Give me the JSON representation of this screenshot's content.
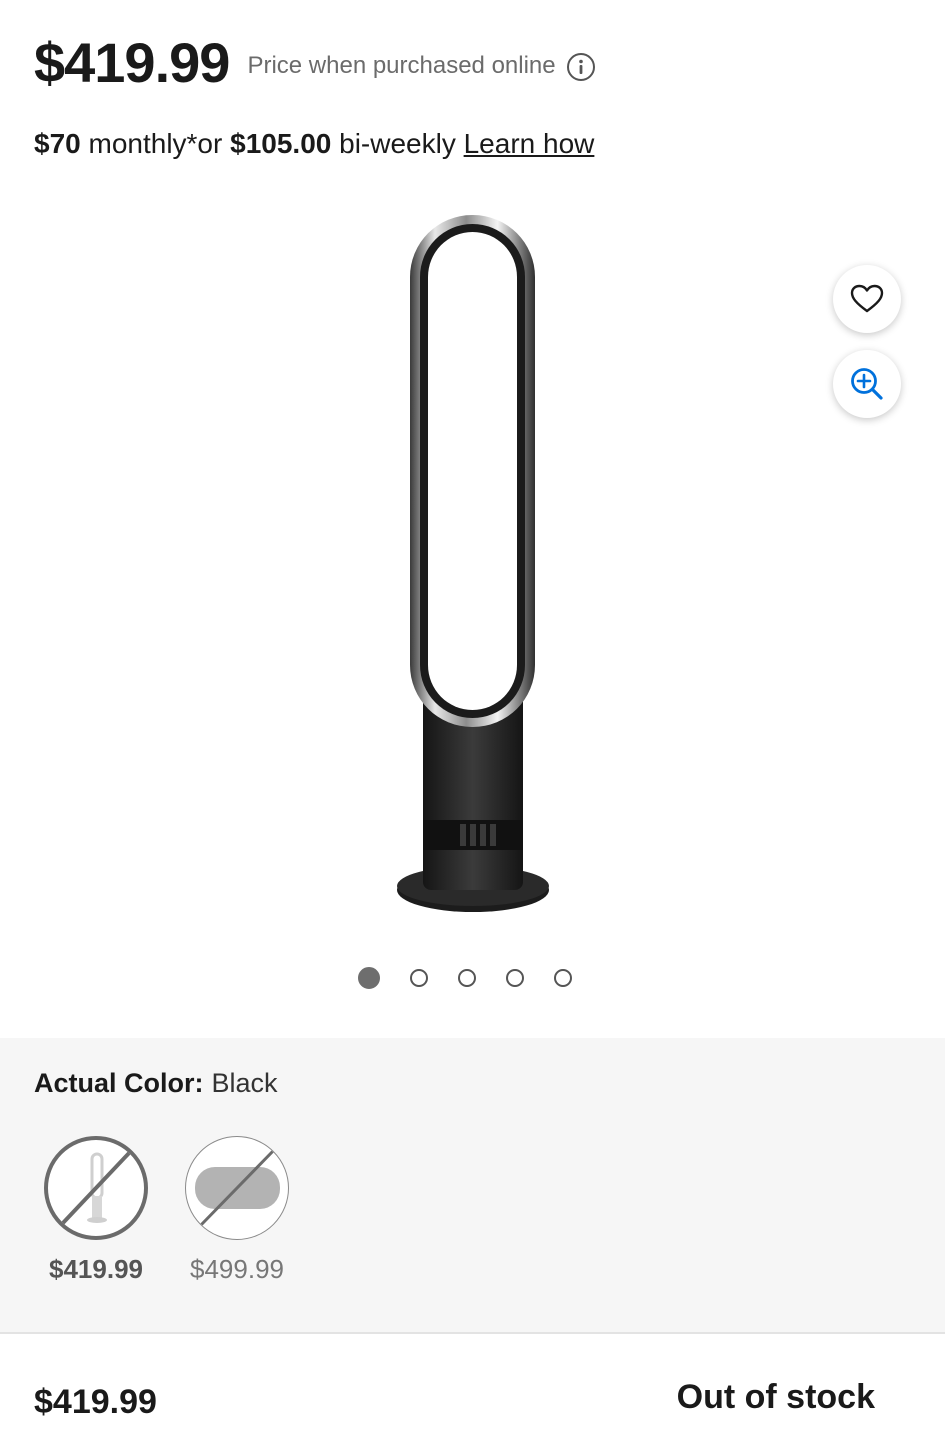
{
  "header": {
    "price": "$419.99",
    "price_note": "Price when purchased online"
  },
  "financing": {
    "monthly_amount": "$70",
    "monthly_text": " monthly*or ",
    "biweekly_amount": "$105.00",
    "biweekly_text": " bi-weekly ",
    "link": "Learn how"
  },
  "gallery": {
    "image_count": 5,
    "active_index": 0
  },
  "color_options": {
    "label": "Actual Color:",
    "value": "Black",
    "swatches": [
      {
        "price": "$419.99",
        "selected": true
      },
      {
        "price": "$499.99",
        "selected": false
      }
    ]
  },
  "footer": {
    "price": "$419.99",
    "status": "Out of stock"
  },
  "colors": {
    "text": "#1a1a1a",
    "muted": "#6b6b6b",
    "accent_blue": "#0071dc",
    "panel_bg": "#f6f6f6"
  }
}
